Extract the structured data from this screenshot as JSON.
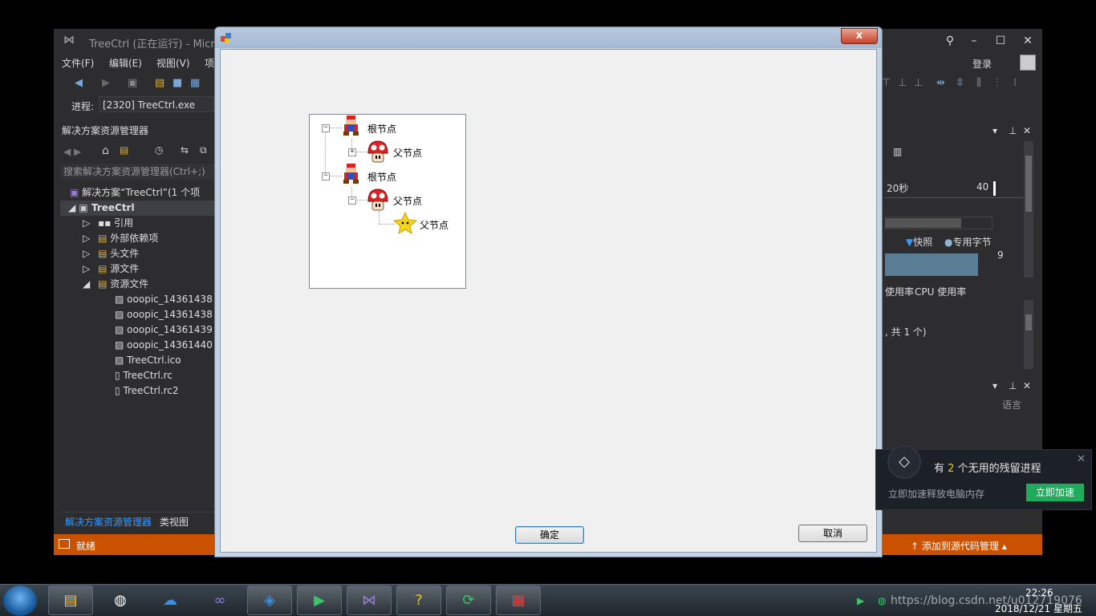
{
  "ide": {
    "title": "TreeCtrl (正在运行) - Micro",
    "menu": [
      "文件(F)",
      "编辑(E)",
      "视图(V)",
      "项"
    ],
    "login": "登录",
    "process_label": "进程:",
    "process_value": "[2320] TreeCtrl.exe",
    "solution_explorer": {
      "header": "解决方案资源管理器",
      "search_placeholder": "搜索解决方案资源管理器(Ctrl+;)",
      "items": [
        {
          "label": "解决方案“TreeCtrl”(1 个项"
        },
        {
          "label": "TreeCtrl"
        },
        {
          "label": "引用"
        },
        {
          "label": "外部依赖项"
        },
        {
          "label": "头文件"
        },
        {
          "label": "源文件"
        },
        {
          "label": "资源文件"
        },
        {
          "label": "ooopic_14361438"
        },
        {
          "label": "ooopic_14361438"
        },
        {
          "label": "ooopic_14361439"
        },
        {
          "label": "ooopic_14361440"
        },
        {
          "label": "TreeCtrl.ico"
        },
        {
          "label": "TreeCtrl.rc"
        },
        {
          "label": "TreeCtrl.rc2"
        }
      ],
      "tab_active": "解决方案资源管理器",
      "tab_other": "类视图"
    },
    "diagnostics": {
      "tick_20": "20秒",
      "tick_40": "40",
      "legend_snapshot": "快照",
      "legend_private": "专用字节",
      "value_9": "9",
      "tab_usage": "使用率",
      "tab_cpu": "CPU 使用率",
      "count_text": ", 共 1 个)",
      "language_col": "语言"
    },
    "status_ready": "就绪",
    "status_git": "添加到源代码管理"
  },
  "dialog": {
    "close_glyph": "x",
    "tree": {
      "nodes": [
        {
          "label": "根节点"
        },
        {
          "label": "父节点"
        },
        {
          "label": "根节点"
        },
        {
          "label": "父节点"
        },
        {
          "label": "父节点"
        }
      ]
    },
    "ok_label": "确定",
    "cancel_label": "取消"
  },
  "notification": {
    "title_prefix": "有",
    "count": "2",
    "title_suffix": "个无用的残留进程",
    "subtitle": "立即加速释放电脑内存",
    "button": "立即加速"
  },
  "taskbar": {
    "time": "22:26",
    "date": "2018/12/21 星期五",
    "watermark": "https://blog.csdn.net/u012719076"
  }
}
